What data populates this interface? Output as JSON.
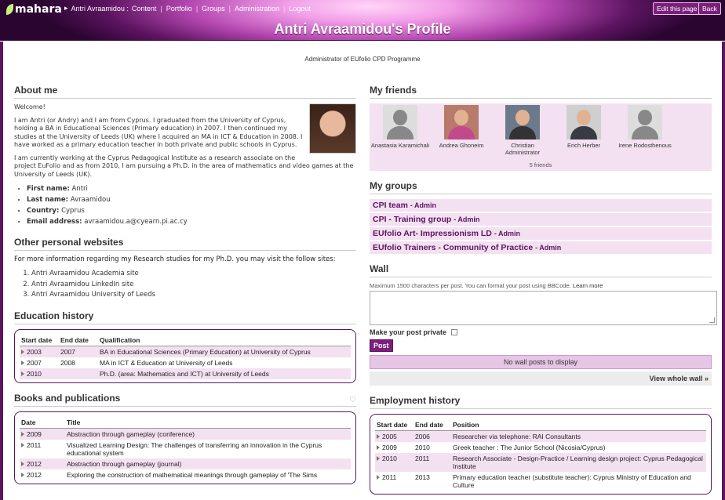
{
  "header": {
    "logo": "mahara",
    "user": "Antri Avraamidou :",
    "nav": [
      "Content",
      "Portfolio",
      "Groups",
      "Administration",
      "Logout"
    ],
    "edit_label": "Edit this page",
    "back_label": "Back",
    "title": "Antri Avraamidou's Profile"
  },
  "subtitle": "Administrator of EUfolio CPD Programme",
  "about": {
    "heading": "About me",
    "p1": "Welcome!",
    "p2": "I am Antri (or Andry) and I am from Cyprus. I graduated from the University of Cyprus, holding a BA in Educational Sciences (Primary education) in 2007. I then continued my studies at the University of Leeds (UK) where I acquired an MA in ICT & Education in 2008. I have worked as a primary education teacher in both private and public schools in Cyprus.",
    "p3": "I am currently working at the Cyprus Pedagogical Institute as a research associate on the project EuFolio  and as from 2010, I am pursuing a Ph.D. in the area of mathematics and video games at the University of Leeds (UK).",
    "props": [
      {
        "label": "First name:",
        "value": "Antri"
      },
      {
        "label": "Last name:",
        "value": "Avraamidou"
      },
      {
        "label": "Country:",
        "value": "Cyprus"
      },
      {
        "label": "Email address:",
        "value": "avraamidou.a@cyearn.pi.ac.cy"
      }
    ]
  },
  "websites": {
    "heading": "Other personal websites",
    "intro": "For more information regarding my Research studies for my Ph.D. you may visit the follow sites:",
    "links": [
      "Antri Avraamidou Academia site",
      "Antri Avraamidou LinkedIn site",
      "Antri Avraamidou University of Leeds"
    ]
  },
  "education": {
    "heading": "Education history",
    "columns": [
      "Start date",
      "End date",
      "Qualification"
    ],
    "rows": [
      [
        "2003",
        "2007",
        "BA in Educational Sciences (Primary Education) at University of Cyprus"
      ],
      [
        "2007",
        "2008",
        "MA in ICT & Education at University of Leeds"
      ],
      [
        "2010",
        "",
        "Ph.D. (area: Mathematics and ICT) at University of Leeds"
      ]
    ]
  },
  "books": {
    "heading": "Books and publications",
    "columns": [
      "Date",
      "Title"
    ],
    "rows": [
      [
        "2009",
        "Abstraction through gameplay (conference)"
      ],
      [
        "2011",
        "Visualized Learning Design: The challenges of transferring an innovation in the Cyprus educational system"
      ],
      [
        "2012",
        "Abstraction through gameplay (journal)"
      ],
      [
        "2012",
        "Exploring the construction of mathematical meanings through gameplay of 'The Sims"
      ]
    ]
  },
  "friends": {
    "heading": "My friends",
    "items": [
      {
        "name": "Anastasia Karamichali",
        "role": ""
      },
      {
        "name": "Andrea Ghoneim",
        "role": ""
      },
      {
        "name": "Christian",
        "role": "Administrator"
      },
      {
        "name": "Erich Herber",
        "role": ""
      },
      {
        "name": "Irene Rodosthenous",
        "role": ""
      }
    ],
    "count": "5 friends"
  },
  "groups": {
    "heading": "My groups",
    "items": [
      {
        "name": "CPI team",
        "role": "- Admin"
      },
      {
        "name": "CPI - Training group",
        "role": "- Admin"
      },
      {
        "name": "EUfolio Art- Impressionism LD",
        "role": "- Admin"
      },
      {
        "name": "EUfolio Trainers - Community of Practice",
        "role": "- Admin"
      }
    ]
  },
  "wall": {
    "heading": "Wall",
    "note": "Maximum 1500 characters per post. You can format your post using BBCode.",
    "learn_more": "Learn more",
    "private_label": "Make your post private",
    "post_label": "Post",
    "empty": "No wall posts to display",
    "view_whole": "View whole wall »"
  },
  "employment": {
    "heading": "Employment history",
    "columns": [
      "Start date",
      "End date",
      "Position"
    ],
    "rows": [
      [
        "2005",
        "2006",
        "Researcher via telephone: RAI Consultants"
      ],
      [
        "2009",
        "2010",
        "Greek teacher : The Junior School (Nicosia/Cyprus)"
      ],
      [
        "2010",
        "2011",
        "Research Associate - Design-Practice / Learning design project: Cyprus Pedagogical Institute"
      ],
      [
        "2011",
        "2013",
        "Primary education teacher (substitute teacher): Cyprus Ministry of Education and Culture"
      ]
    ]
  }
}
